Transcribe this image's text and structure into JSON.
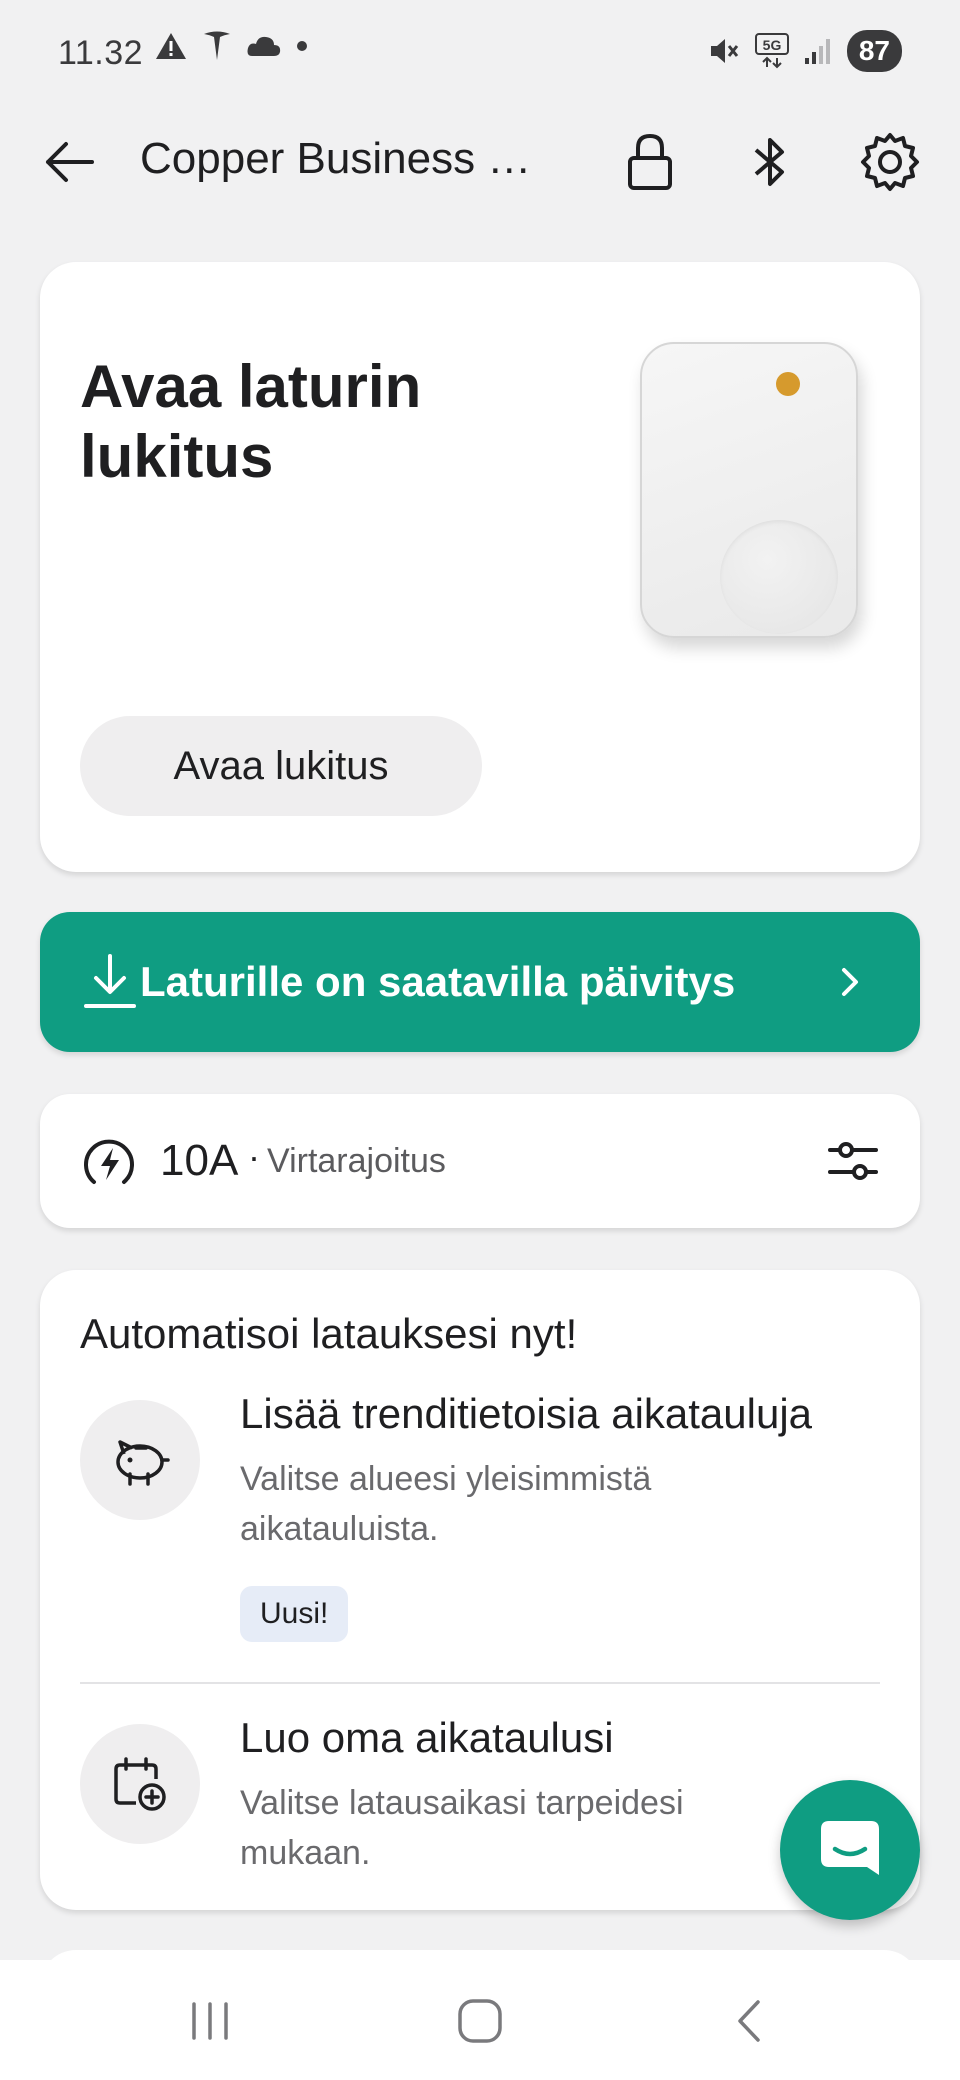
{
  "status_bar": {
    "time": "11.32",
    "network": "5G",
    "battery": "87"
  },
  "app_bar": {
    "title": "Copper Business S..."
  },
  "unlock_card": {
    "title": "Avaa laturin lukitus",
    "button_label": "Avaa lukitus"
  },
  "update_banner": {
    "text": "Laturille on saatavilla päivitys"
  },
  "current_limit": {
    "value": "10A",
    "separator": "·",
    "label": "Virtarajoitus"
  },
  "automation": {
    "title": "Automatisoi latauksesi nyt!",
    "options": [
      {
        "title": "Lisää trenditietoisia aikatauluja",
        "description": "Valitse alueesi yleisimmistä aikatauluista.",
        "badge": "Uusi!",
        "icon": "piggy-bank-icon"
      },
      {
        "title": "Luo oma aikataulusi",
        "description": "Valitse latausaikasi tarpeidesi mukaan.",
        "icon": "calendar-add-icon"
      }
    ]
  },
  "colors": {
    "accent": "#0f9d82",
    "background": "#f1f1f2",
    "card": "#ffffff",
    "charger_led": "#d69a2d"
  }
}
